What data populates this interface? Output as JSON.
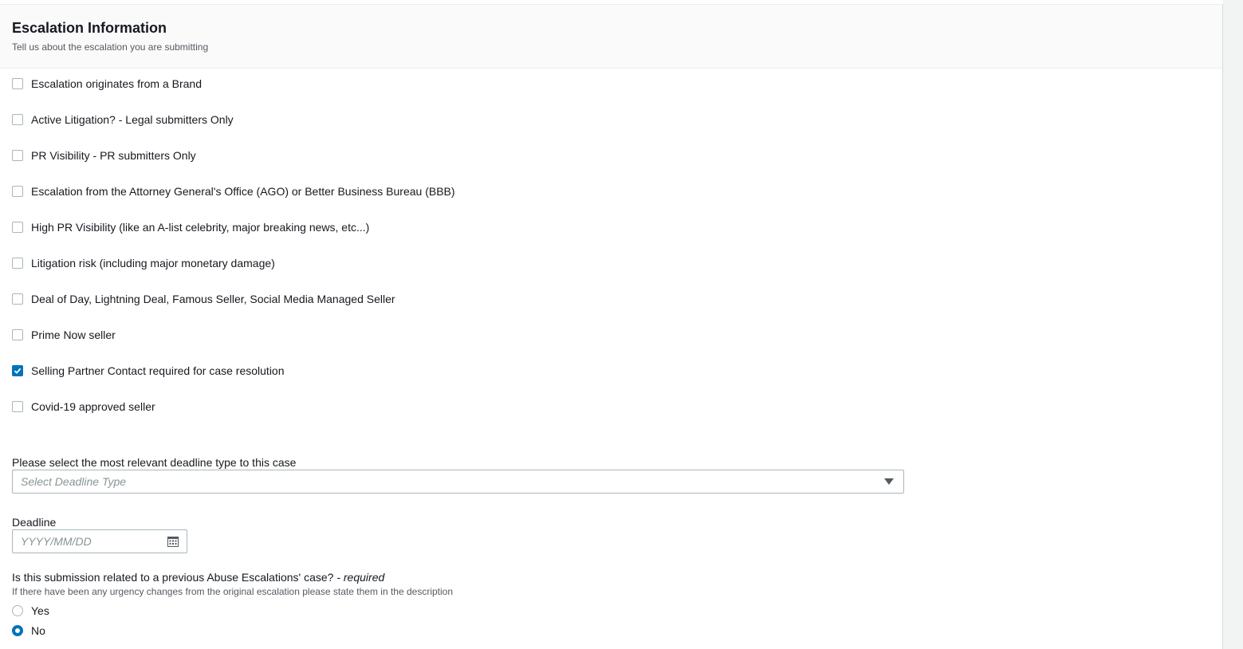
{
  "section": {
    "title": "Escalation Information",
    "subtitle": "Tell us about the escalation you are submitting"
  },
  "checkboxes": [
    {
      "label": "Escalation originates from a Brand",
      "checked": false
    },
    {
      "label": "Active Litigation? - Legal submitters Only",
      "checked": false
    },
    {
      "label": "PR Visibility - PR submitters Only",
      "checked": false
    },
    {
      "label": "Escalation from the Attorney General's Office (AGO) or Better Business Bureau (BBB)",
      "checked": false
    },
    {
      "label": "High PR Visibility (like an A-list celebrity, major breaking news, etc...)",
      "checked": false
    },
    {
      "label": "Litigation risk (including major monetary damage)",
      "checked": false
    },
    {
      "label": "Deal of Day, Lightning Deal, Famous Seller, Social Media Managed Seller",
      "checked": false
    },
    {
      "label": "Prime Now seller",
      "checked": false
    },
    {
      "label": "Selling Partner Contact required for case resolution",
      "checked": true
    },
    {
      "label": "Covid-19 approved seller",
      "checked": false
    }
  ],
  "deadline_type": {
    "label": "Please select the most relevant deadline type to this case",
    "placeholder": "Select Deadline Type"
  },
  "deadline": {
    "label": "Deadline",
    "placeholder": "YYYY/MM/DD",
    "value": ""
  },
  "previous_case": {
    "question": "Is this submission related to a previous Abuse Escalations' case?",
    "required_marker": "- required",
    "hint": "If there have been any urgency changes from the original escalation please state them in the description",
    "options": [
      {
        "label": "Yes",
        "selected": false
      },
      {
        "label": "No",
        "selected": true
      }
    ]
  },
  "colors": {
    "accent": "#0073bb",
    "header_bg": "#fafafa",
    "border": "#aab7b8",
    "placeholder": "#879596"
  },
  "icons": {
    "select_caret": "caret-down-icon",
    "calendar": "calendar-icon",
    "checkmark": "checkmark-icon"
  }
}
